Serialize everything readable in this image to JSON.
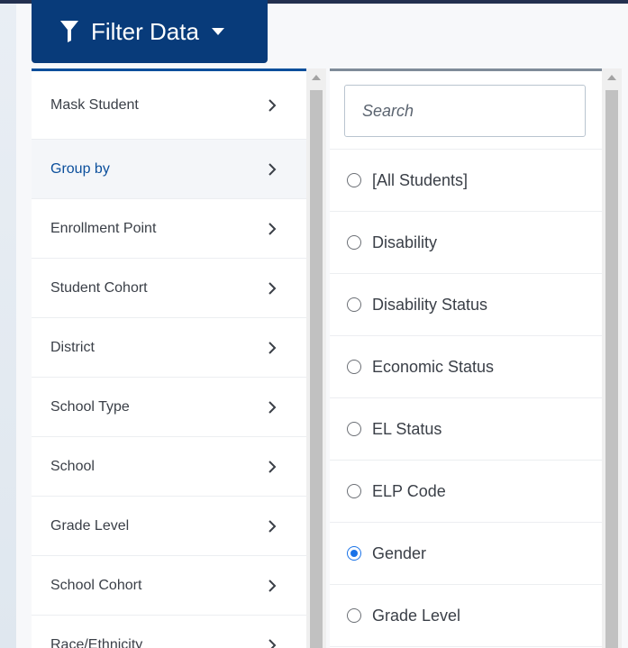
{
  "filter_button": {
    "label": "Filter Data"
  },
  "left_menu": {
    "items": [
      {
        "label": "Mask Student"
      },
      {
        "label": "Group by"
      },
      {
        "label": "Enrollment Point"
      },
      {
        "label": "Student Cohort"
      },
      {
        "label": "District"
      },
      {
        "label": "School Type"
      },
      {
        "label": "School"
      },
      {
        "label": "Grade Level"
      },
      {
        "label": "School Cohort"
      },
      {
        "label": "Race/Ethnicity"
      }
    ],
    "active_item": "Group by"
  },
  "group_by_panel": {
    "search_placeholder": "Search",
    "options": [
      {
        "label": "[All Students]",
        "selected": false
      },
      {
        "label": "Disability",
        "selected": false
      },
      {
        "label": "Disability Status",
        "selected": false
      },
      {
        "label": "Economic Status",
        "selected": false
      },
      {
        "label": "EL Status",
        "selected": false
      },
      {
        "label": "ELP Code",
        "selected": false
      },
      {
        "label": "Gender",
        "selected": true
      },
      {
        "label": "Grade Level",
        "selected": false
      }
    ]
  },
  "colors": {
    "button_bg": "#083b7a",
    "accent": "#0b4f9c",
    "radio_selected": "#1a73e8"
  },
  "icons": {
    "filter": "funnel-icon",
    "dropdown": "caret-down-icon",
    "submenu": "chevron-right-icon"
  }
}
